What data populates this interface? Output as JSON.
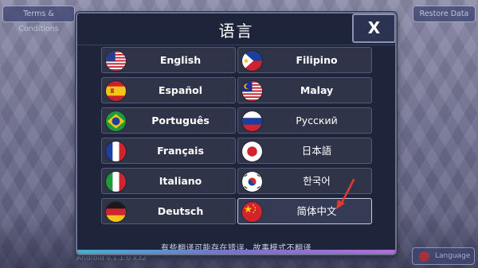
{
  "background": {
    "terms_label": "Terms & Conditions",
    "restore_label": "Restore Data",
    "version_text": "Android v.1.1.0 x32",
    "language_label": "Language"
  },
  "dialog": {
    "title": "语言",
    "close_label": "X",
    "note": "有些翻译可能存在错误，故事模式不翻译",
    "languages": [
      {
        "label": "English",
        "flag": "us-flag"
      },
      {
        "label": "Filipino",
        "flag": "philippines-flag"
      },
      {
        "label": "Español",
        "flag": "spain-flag"
      },
      {
        "label": "Malay",
        "flag": "malaysia-flag"
      },
      {
        "label": "Português",
        "flag": "brazil-flag"
      },
      {
        "label": "Русский",
        "flag": "russia-flag"
      },
      {
        "label": "Français",
        "flag": "france-flag"
      },
      {
        "label": "日本語",
        "flag": "japan-flag"
      },
      {
        "label": "Italiano",
        "flag": "italy-flag"
      },
      {
        "label": "한국어",
        "flag": "south-korea-flag"
      },
      {
        "label": "Deutsch",
        "flag": "germany-flag"
      },
      {
        "label": "简体中文",
        "flag": "china-flag"
      }
    ],
    "selected_language": "简体中文"
  },
  "colors": {
    "dialog_bg": "#1e2439",
    "button_bg": "#2f3449",
    "arrow": "#e03b2f"
  }
}
